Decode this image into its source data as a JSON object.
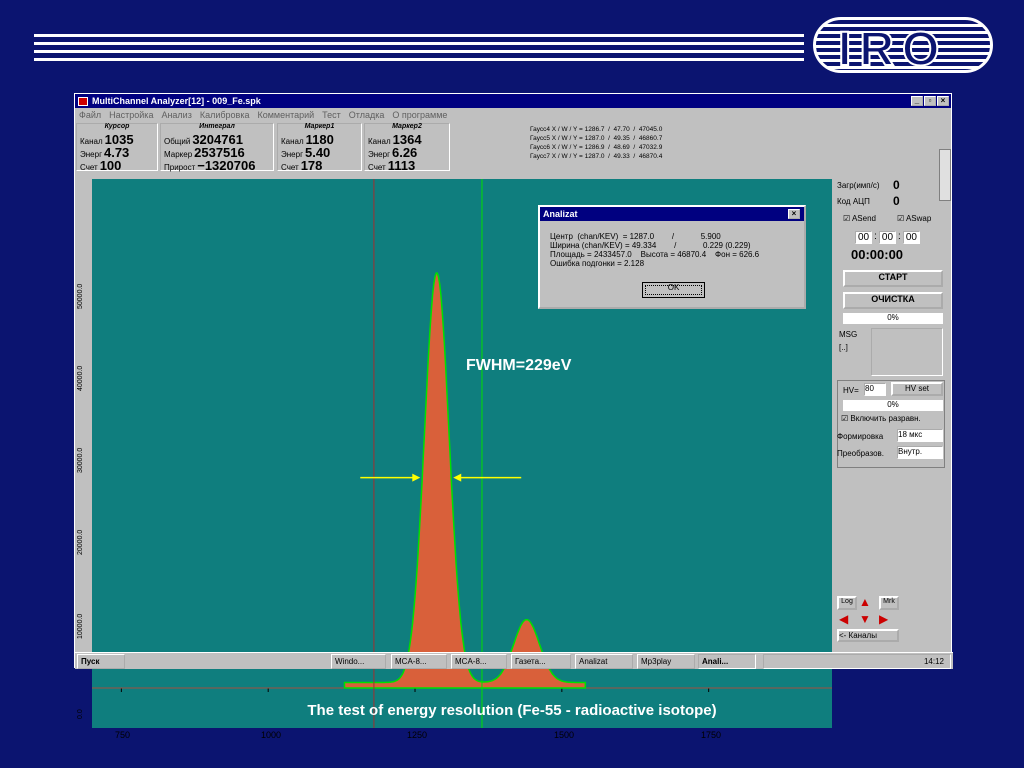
{
  "logo": "IRO",
  "window": {
    "title": "MultiChannel Analyzer[12] - 009_Fe.spk"
  },
  "menu": [
    "Файл",
    "Настройка",
    "Анализ",
    "Калибровка",
    "Комментарий",
    "Тест",
    "Отладка",
    "О программе"
  ],
  "cursor": {
    "header": "Курсор",
    "channel_label": "Канал",
    "channel": "1035",
    "energy_label": "Энерг",
    "energy": "4.73",
    "count_label": "Счет",
    "count": "100"
  },
  "integral": {
    "header": "Интеграл",
    "total_label": "Общий",
    "total": "3204761",
    "marker_label": "Маркер",
    "marker": "2537516",
    "gain_label": "Прирост",
    "gain": "−1320706"
  },
  "marker1": {
    "header": "Маркер1",
    "channel_label": "Канал",
    "channel": "1180",
    "energy_label": "Энерг",
    "energy": "5.40",
    "count_label": "Счет",
    "count": "178"
  },
  "marker2": {
    "header": "Маркер2",
    "channel_label": "Канал",
    "channel": "1364",
    "energy_label": "Энерг",
    "energy": "6.26",
    "count_label": "Счет",
    "count": "1113"
  },
  "gauss_lines": [
    "Гаусс4 X / W / Y = 1286.7  /  47.70  /  47045.0",
    "Гаусс5 X / W / Y = 1287.0  /  49.35  /  46860.7",
    "Гаусс6 X / W / Y = 1286.9  /  48.69  /  47032.9",
    "Гаусс7 X / W / Y = 1287.0  /  49.33  /  46870.4"
  ],
  "side": {
    "load_label": "Загр(имп/с)",
    "load": "0",
    "adc_label": "Код АЦП",
    "adc": "0",
    "asend": "ASend",
    "aswap": "ASwap",
    "t1": "00",
    "t2": "00",
    "t3": "00",
    "timer": "00:00:00",
    "start": "СТАРТ",
    "clear": "ОЧИСТКА",
    "pct1": "0%",
    "msg_label": "MSG",
    "msg": "[..]",
    "hv_label": "HV=",
    "hv": "80",
    "hv_set": "HV set",
    "pct2": "0%",
    "enable": "Включить разравн.",
    "form_label": "Формировка",
    "form": "18 мкс",
    "conv_label": "Преобразов.",
    "conv": "Внутр.",
    "log": "Log",
    "mrk": "Mrk",
    "channels": "<- Каналы"
  },
  "dialog": {
    "title": "Analizat",
    "lines": [
      "Центр  (chan/KEV)  = 1287.0        /            5.900",
      "Ширина (chan/KEV) = 49.334        /            0.229 (0.229)",
      "Площадь = 2433457.0    Высота = 46870.4    Фон = 626.6",
      "Ошибка подгонки = 2.128"
    ],
    "ok": "OK"
  },
  "annotation": "FWHM=229eV",
  "taskbar": {
    "start": "Пуск",
    "items": [
      "Windo...",
      "MCA-8...",
      "MCA-8...",
      "Газета...",
      "Analizat",
      "Mp3play",
      "Anali..."
    ],
    "clock": "14:12"
  },
  "caption": "The test of energy resolution (Fe-55 - radioactive isotope)",
  "chart_data": {
    "type": "area",
    "x_ticks": [
      750,
      1000,
      1250,
      1500,
      1750
    ],
    "y_ticks": [
      "0.0",
      "10000.0",
      "20000.0",
      "30000.0",
      "40000.0",
      "50000.0"
    ],
    "xlim": [
      700,
      1960
    ],
    "ylim": [
      0,
      55000
    ],
    "series": [
      {
        "peaks": [
          {
            "center": 1287,
            "width": 49.3,
            "height": 46870
          },
          {
            "center": 1440,
            "width": 52,
            "height": 7200
          }
        ],
        "background": 626.6
      }
    ],
    "markers": [
      1180,
      1364
    ]
  }
}
